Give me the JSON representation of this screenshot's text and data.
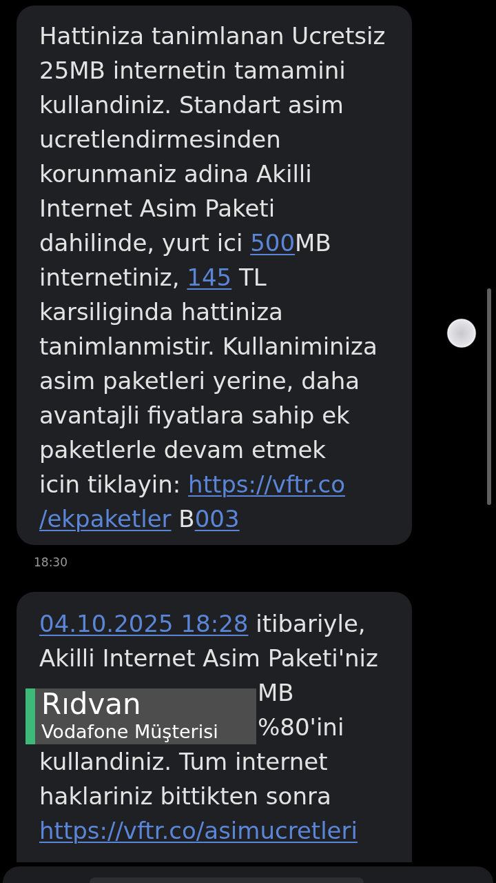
{
  "messages": [
    {
      "blocks": [
        {
          "kind": "text",
          "lines": [
            [
              {
                "kind": "text",
                "text": "Hattiniza tanimlanan Ucretsiz"
              }
            ],
            [
              {
                "kind": "text",
                "text": "25MB internetin tamamini"
              }
            ],
            [
              {
                "kind": "text",
                "text": "kullandiniz. Standart asim"
              }
            ],
            [
              {
                "kind": "text",
                "text": "ucretlendirmesinden"
              }
            ],
            [
              {
                "kind": "text",
                "text": "korunmaniz adina Akilli"
              }
            ],
            [
              {
                "kind": "text",
                "text": "Internet Asim Paketi"
              }
            ],
            [
              {
                "kind": "text",
                "text": "dahilinde, yurt ici "
              },
              {
                "kind": "link",
                "text": "500"
              },
              {
                "kind": "text",
                "text": "MB"
              }
            ],
            [
              {
                "kind": "text",
                "text": "internetiniz, "
              },
              {
                "kind": "link",
                "text": "145"
              },
              {
                "kind": "text",
                "text": " TL"
              }
            ],
            [
              {
                "kind": "text",
                "text": "karsiliginda hattiniza"
              }
            ],
            [
              {
                "kind": "text",
                "text": "tanimlanmistir. Kullaniminiza"
              }
            ],
            [
              {
                "kind": "text",
                "text": "asim paketleri yerine, daha"
              }
            ],
            [
              {
                "kind": "text",
                "text": "avantajli fiyatlara sahip ek"
              }
            ],
            [
              {
                "kind": "text",
                "text": "paketlerle devam etmek"
              }
            ],
            [
              {
                "kind": "text",
                "text": "icin tiklayin: "
              },
              {
                "kind": "link",
                "text": "https://vftr.co"
              }
            ],
            [
              {
                "kind": "link",
                "text": "/ekpaketler"
              },
              {
                "kind": "text",
                "text": " B"
              },
              {
                "kind": "link",
                "text": "003"
              }
            ]
          ]
        }
      ],
      "time": "18:30"
    },
    {
      "blocks": [
        {
          "kind": "text",
          "lines": [
            [
              {
                "kind": "link",
                "text": "04.10.2025 18:28"
              },
              {
                "kind": "text",
                "text": " itibariyle,"
              }
            ],
            [
              {
                "kind": "text",
                "text": "Akilli Internet Asim Paketi'niz"
              }
            ]
          ]
        },
        {
          "kind": "behind_caption",
          "lines": [
            [
              {
                "kind": "text",
                "text": "MB"
              }
            ],
            [
              {
                "kind": "text",
                "text": "%80'ini"
              }
            ]
          ]
        },
        {
          "kind": "text",
          "lines": [
            [
              {
                "kind": "text",
                "text": "kullandiniz. Tum internet"
              }
            ],
            [
              {
                "kind": "text",
                "text": "haklariniz bittikten sonra"
              }
            ],
            [
              {
                "kind": "link",
                "text": "https://vftr.co/asimucretleri"
              }
            ]
          ]
        }
      ]
    }
  ],
  "caption": {
    "name": "Rıdvan",
    "subtitle": "Vodafone Müşterisi"
  }
}
